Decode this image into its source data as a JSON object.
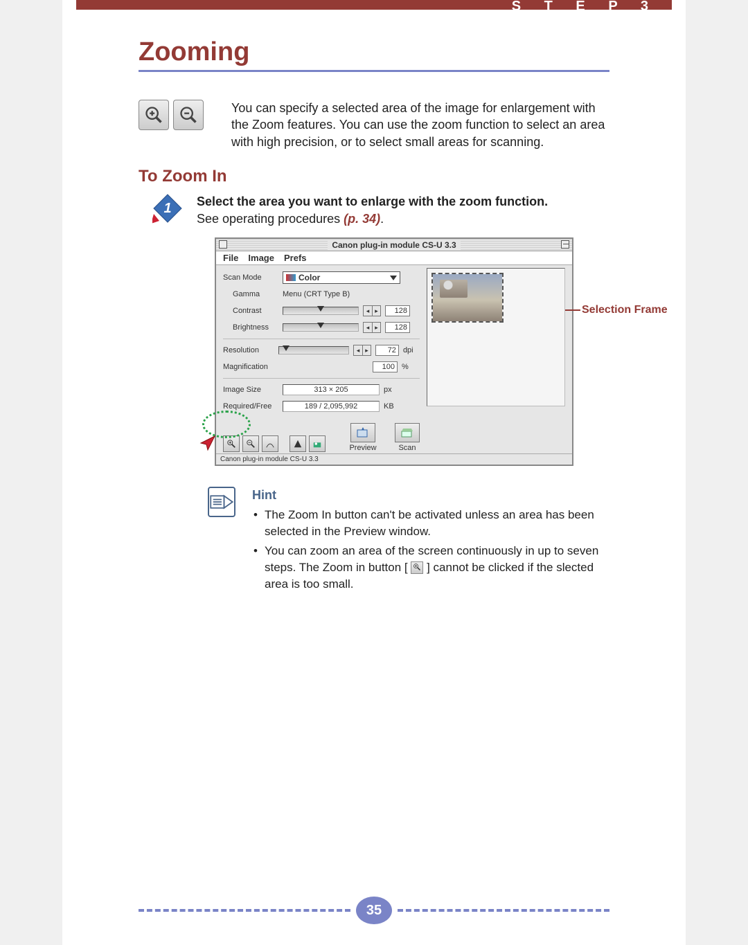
{
  "header": {
    "step_label": "S T E P   3"
  },
  "title": "Zooming",
  "intro": "You can specify a selected area of the image for enlargement with the Zoom features.  You can use the zoom function to select an area with high precision, or to select small areas for scanning.",
  "subheading": "To Zoom In",
  "step1": {
    "title": "Select the area you want to enlarge with the zoom function.",
    "subtitle": "See operating procedures ",
    "ref": "(p. 34)",
    "period": "."
  },
  "callout": {
    "selection_frame": "Selection Frame"
  },
  "window": {
    "title": "Canon plug-in module CS-U 3.3",
    "menus": [
      "File",
      "Image",
      "Prefs"
    ],
    "rows": {
      "scan_mode": {
        "label": "Scan Mode",
        "value": "Color"
      },
      "gamma": {
        "label": "Gamma",
        "value": "Menu (CRT Type B)"
      },
      "contrast": {
        "label": "Contrast",
        "value": "128"
      },
      "brightness": {
        "label": "Brightness",
        "value": "128"
      },
      "resolution": {
        "label": "Resolution",
        "value": "72",
        "unit": "dpi"
      },
      "magnification": {
        "label": "Magnification",
        "value": "100",
        "unit": "%"
      },
      "image_size": {
        "label": "Image Size",
        "value": "313 × 205",
        "unit": "px"
      },
      "required_free": {
        "label": "Required/Free",
        "value": "189 / 2,095,992",
        "unit": "KB"
      }
    },
    "buttons": {
      "preview": "Preview",
      "scan": "Scan"
    },
    "status": "Canon plug-in module CS-U 3.3"
  },
  "hint": {
    "title": "Hint",
    "items": [
      "The Zoom In button can't be activated unless an area has been selected in the Preview window.",
      "You can zoom an area of the screen continuously in up to seven steps. The Zoom in button [  ] cannot be clicked if the slected area is too small."
    ]
  },
  "page_number": "35"
}
